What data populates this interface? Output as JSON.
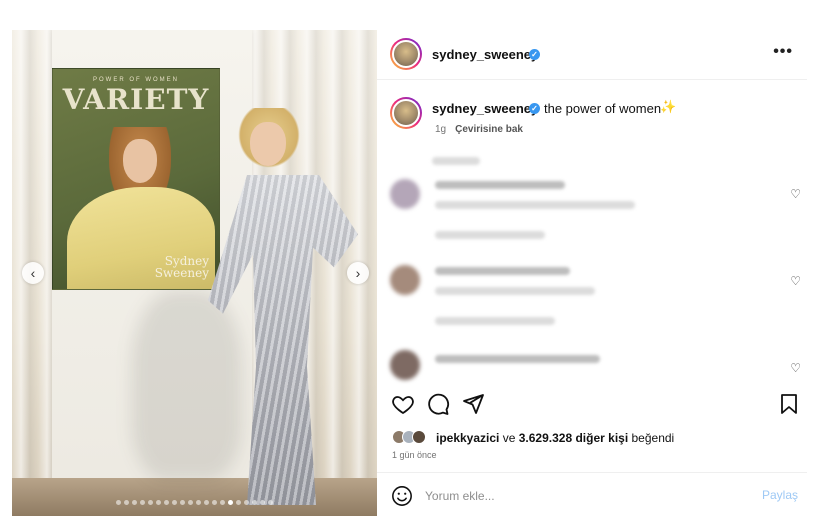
{
  "media": {
    "cover_kicker": "POWER OF WOMEN",
    "cover_magazine": "VARIETY",
    "cover_name_line1": "Sydney",
    "cover_name_line2": "Sweeney",
    "prev_icon": "chevron-left-icon",
    "next_icon": "chevron-right-icon",
    "prev_glyph": "‹",
    "next_glyph": "›",
    "carousel_total": 20,
    "carousel_active": 14
  },
  "header": {
    "username": "sydney_sweeney",
    "verified_glyph": "✓",
    "more_glyph": "•••"
  },
  "caption": {
    "username": "sydney_sweeney",
    "verified_glyph": "✓",
    "text": "the power of women",
    "sparkle": "✨",
    "age": "1g",
    "translate": "Çevirisine bak"
  },
  "actions": {
    "like_icon": "heart-icon",
    "comment_icon": "comment-icon",
    "share_icon": "send-icon",
    "save_icon": "bookmark-icon"
  },
  "likes": {
    "user": "ipekkyazici",
    "connector": "ve",
    "count": "3.629.328 diğer kişi",
    "suffix": "beğendi"
  },
  "time": "1 gün önce",
  "comment_box": {
    "placeholder": "Yorum ekle...",
    "share_label": "Paylaş"
  },
  "colors": {
    "accent": "#3897f0",
    "share_disabled": "#9ec9f5",
    "story_ring_start": "#f9ce34",
    "story_ring_mid": "#ee2a7b",
    "story_ring_end": "#6228d7"
  }
}
